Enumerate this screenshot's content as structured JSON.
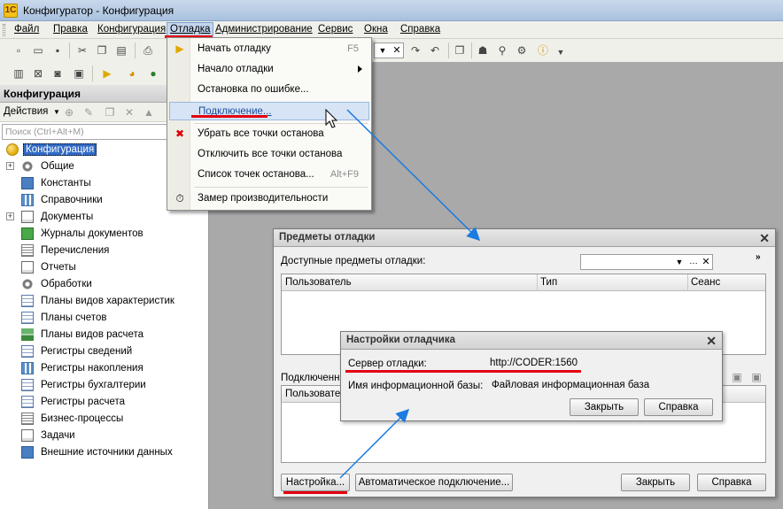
{
  "window": {
    "title": "Конфигуратор - Конфигурация"
  },
  "menubar": {
    "items": [
      {
        "label": "Файл"
      },
      {
        "label": "Правка"
      },
      {
        "label": "Конфигурация"
      },
      {
        "label": "Отладка"
      },
      {
        "label": "Администрирование"
      },
      {
        "label": "Сервис"
      },
      {
        "label": "Окна"
      },
      {
        "label": "Справка"
      }
    ]
  },
  "debug_menu": {
    "items": [
      {
        "label": "Начать отладку",
        "shortcut": "F5"
      },
      {
        "label": "Начало отладки"
      },
      {
        "label": "Остановка по ошибке..."
      },
      {
        "label": "Подключение..."
      },
      {
        "label": "Убрать все точки останова"
      },
      {
        "label": "Отключить все точки останова"
      },
      {
        "label": "Список точек останова...",
        "shortcut": "Alt+F9"
      },
      {
        "label": "Замер производительности"
      }
    ]
  },
  "left_panel": {
    "title": "Конфигурация",
    "actions_label": "Действия",
    "search_placeholder": "Поиск (Ctrl+Alt+M)",
    "tree": [
      {
        "label": "Конфигурация",
        "icon": "config-ball-icon"
      },
      {
        "label": "Общие",
        "icon": "common-icon"
      },
      {
        "label": "Константы",
        "icon": "constants-icon"
      },
      {
        "label": "Справочники",
        "icon": "catalogs-icon"
      },
      {
        "label": "Документы",
        "icon": "documents-icon"
      },
      {
        "label": "Журналы документов",
        "icon": "journals-icon"
      },
      {
        "label": "Перечисления",
        "icon": "enums-icon"
      },
      {
        "label": "Отчеты",
        "icon": "reports-icon"
      },
      {
        "label": "Обработки",
        "icon": "processing-icon"
      },
      {
        "label": "Планы видов характеристик",
        "icon": "chart-characteristics-icon"
      },
      {
        "label": "Планы счетов",
        "icon": "chart-accounts-icon"
      },
      {
        "label": "Планы видов расчета",
        "icon": "chart-calc-icon"
      },
      {
        "label": "Регистры сведений",
        "icon": "info-registers-icon"
      },
      {
        "label": "Регистры накопления",
        "icon": "accum-registers-icon"
      },
      {
        "label": "Регистры бухгалтерии",
        "icon": "account-registers-icon"
      },
      {
        "label": "Регистры расчета",
        "icon": "calc-registers-icon"
      },
      {
        "label": "Бизнес-процессы",
        "icon": "business-process-icon"
      },
      {
        "label": "Задачи",
        "icon": "tasks-icon"
      },
      {
        "label": "Внешние источники данных",
        "icon": "external-sources-icon"
      }
    ]
  },
  "debug_items_window": {
    "title": "Предметы отладки",
    "available_label": "Доступные предметы отладки:",
    "columns": [
      "Пользователь",
      "Тип",
      "Сеанс"
    ],
    "connected_label": "Подключенн",
    "connected_column": "Пользовате",
    "buttons": {
      "settings": "Настройка...",
      "auto_connect": "Автоматическое подключение...",
      "close": "Закрыть",
      "help": "Справка"
    }
  },
  "debugger_settings_window": {
    "title": "Настройки отладчика",
    "server_label": "Сервер отладки:",
    "server_value": "http://CODER:1560",
    "ib_label": "Имя информационной базы:",
    "ib_value": "Файловая информационная база",
    "buttons": {
      "close": "Закрыть",
      "help": "Справка"
    }
  },
  "colors": {
    "highlight": "#e3000f",
    "arrow": "#1c7be0"
  }
}
